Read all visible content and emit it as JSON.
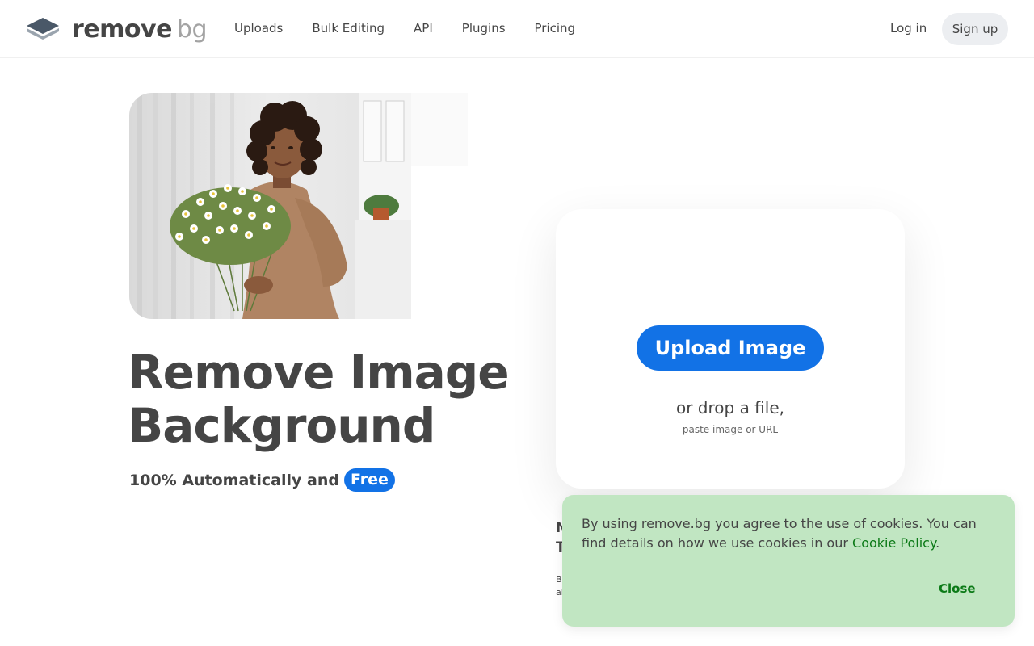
{
  "header": {
    "logo_main": "remove",
    "logo_accent": "bg",
    "nav": [
      "Uploads",
      "Bulk Editing",
      "API",
      "Plugins",
      "Pricing"
    ],
    "login": "Log in",
    "signup": "Sign up"
  },
  "hero": {
    "title_line1": "Remove Image",
    "title_line2": "Background",
    "subtitle": "100% Automatically and",
    "badge": "Free"
  },
  "upload": {
    "button": "Upload Image",
    "drop_text": "or drop a file,",
    "paste_prefix": "paste image or",
    "url_link": "URL"
  },
  "peek": {
    "line1": "N",
    "line2": "T",
    "line3": "B",
    "line4": "al"
  },
  "cookie": {
    "text_before": "By using remove.bg you agree to the use of cookies. You can find details on how we use cookies in our",
    "link": "Cookie Policy",
    "text_after": ".",
    "close": "Close"
  },
  "colors": {
    "brand_blue": "#1272e6",
    "cookie_bg": "#c1e6c2",
    "cookie_link": "#0c7a17"
  }
}
